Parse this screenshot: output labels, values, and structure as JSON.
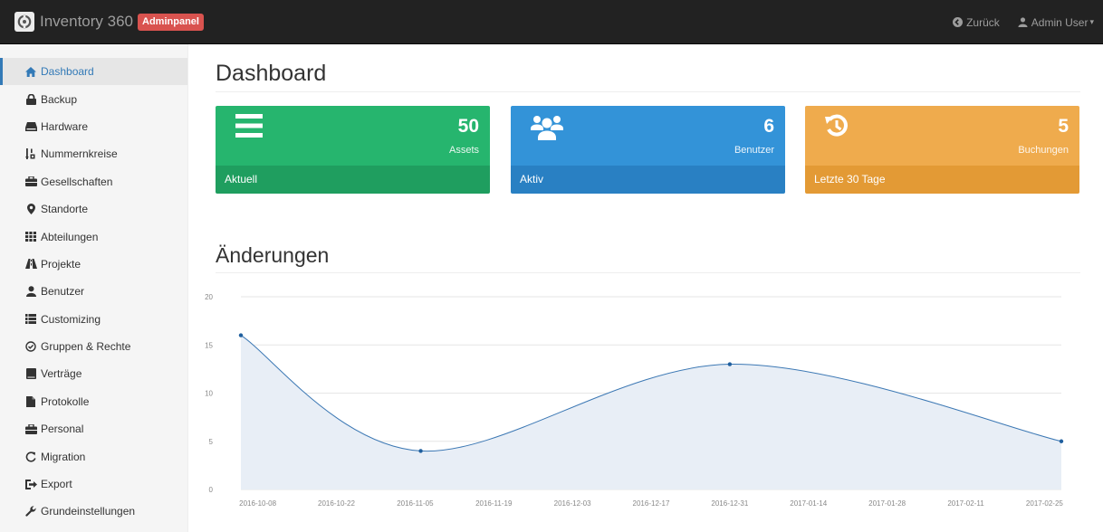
{
  "navbar": {
    "brand_name": "Inventory 360",
    "badge": "Adminpanel",
    "back_label": "Zurück",
    "user_label": "Admin User",
    "caret": "▾"
  },
  "sidebar": {
    "items": [
      {
        "label": "Dashboard",
        "icon": "home-icon"
      },
      {
        "label": "Backup",
        "icon": "lock-icon"
      },
      {
        "label": "Hardware",
        "icon": "hdd-icon"
      },
      {
        "label": "Nummernkreise",
        "icon": "sort-numeric-icon"
      },
      {
        "label": "Gesellschaften",
        "icon": "briefcase-icon"
      },
      {
        "label": "Standorte",
        "icon": "map-marker-icon"
      },
      {
        "label": "Abteilungen",
        "icon": "th-icon"
      },
      {
        "label": "Projekte",
        "icon": "road-icon"
      },
      {
        "label": "Benutzer",
        "icon": "user-icon"
      },
      {
        "label": "Customizing",
        "icon": "list-icon"
      },
      {
        "label": "Gruppen & Rechte",
        "icon": "check-circle-icon"
      },
      {
        "label": "Verträge",
        "icon": "book-icon"
      },
      {
        "label": "Protokolle",
        "icon": "file-icon"
      },
      {
        "label": "Personal",
        "icon": "briefcase-icon"
      },
      {
        "label": "Migration",
        "icon": "refresh-icon"
      },
      {
        "label": "Export",
        "icon": "export-icon"
      },
      {
        "label": "Grundeinstellungen",
        "icon": "wrench-icon"
      }
    ]
  },
  "main": {
    "title": "Dashboard",
    "cards": [
      {
        "value": "50",
        "label": "Assets",
        "footer": "Aktuell",
        "icon": "menu-icon"
      },
      {
        "value": "6",
        "label": "Benutzer",
        "footer": "Aktiv",
        "icon": "users-icon"
      },
      {
        "value": "5",
        "label": "Buchungen",
        "footer": "Letzte 30 Tage",
        "icon": "history-icon"
      }
    ],
    "section_title": "Änderungen"
  },
  "chart_data": {
    "type": "area",
    "title": "",
    "xlabel": "",
    "ylabel": "",
    "ylim": [
      0,
      20
    ],
    "y_ticks": [
      "0",
      "5",
      "10",
      "15",
      "20"
    ],
    "x_ticks": [
      "2016-10-08",
      "2016-10-22",
      "2016-11-05",
      "2016-11-19",
      "2016-12-03",
      "2016-12-17",
      "2016-12-31",
      "2017-01-14",
      "2017-01-28",
      "2017-02-11",
      "2017-02-25"
    ],
    "x_range": [
      "2016-10-05",
      "2017-02-28"
    ],
    "points": [
      {
        "x": "2016-10-05",
        "y": 16
      },
      {
        "x": "2016-11-06",
        "y": 4
      },
      {
        "x": "2016-12-31",
        "y": 13
      },
      {
        "x": "2017-02-28",
        "y": 5
      }
    ],
    "grid": true,
    "line_color": "#3c78b4",
    "fill_color": "#e8eef6"
  }
}
